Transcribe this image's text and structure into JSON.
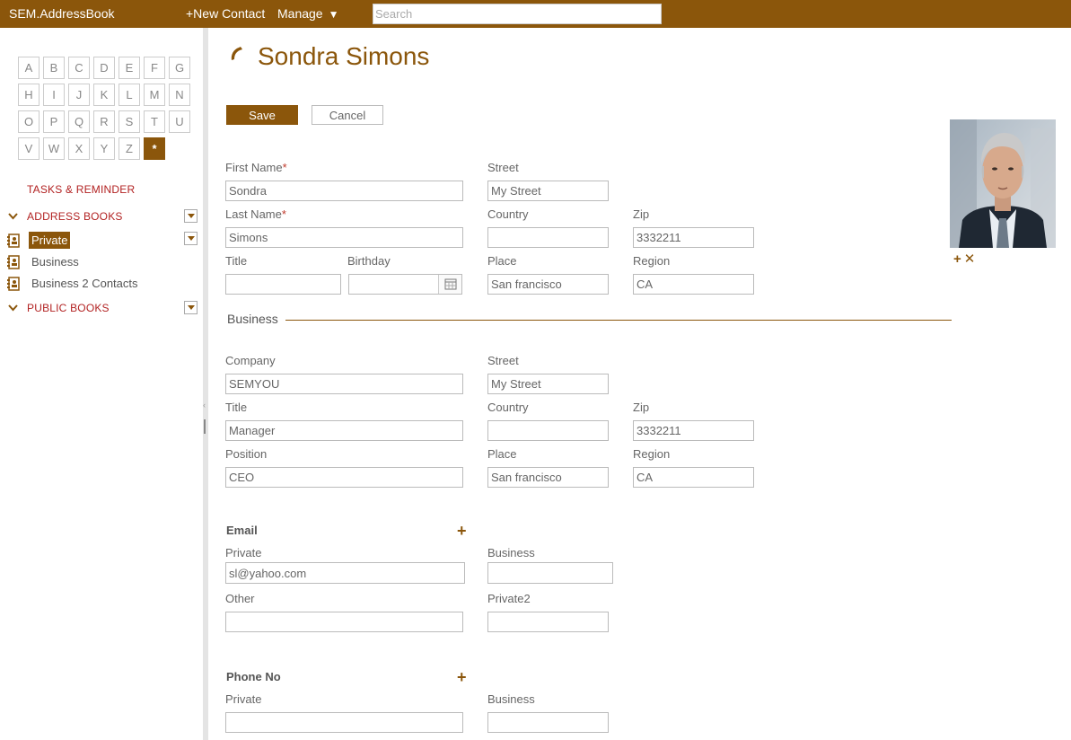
{
  "app": {
    "brand": "SEM.AddressBook",
    "new_contact": "+New Contact",
    "manage": "Manage",
    "search_placeholder": "Search"
  },
  "sidebar": {
    "letters": [
      "A",
      "B",
      "C",
      "D",
      "E",
      "F",
      "G",
      "H",
      "I",
      "J",
      "K",
      "L",
      "M",
      "N",
      "O",
      "P",
      "Q",
      "R",
      "S",
      "T",
      "U",
      "V",
      "W",
      "X",
      "Y",
      "Z",
      "*"
    ],
    "active_letter": "*",
    "tasks": "TASKS & REMINDER",
    "address_books": "ADDRESS BOOKS",
    "books": [
      "Private",
      "Business",
      "Business 2 Contacts"
    ],
    "selected_book": "Private",
    "public_books": "PUBLIC BOOKS"
  },
  "contact": {
    "name": "Sondra Simons",
    "save": "Save",
    "cancel": "Cancel",
    "labels": {
      "first_name": "First Name",
      "last_name": "Last Name",
      "title": "Title",
      "birthday": "Birthday",
      "street": "Street",
      "country": "Country",
      "zip": "Zip",
      "place": "Place",
      "region": "Region",
      "company": "Company",
      "position": "Position",
      "required_mark": "*"
    },
    "private": {
      "first_name": "Sondra",
      "last_name": "Simons",
      "title": "",
      "birthday": "",
      "street": "My Street",
      "country": "",
      "zip": "3332211",
      "place": "San francisco",
      "region": "CA"
    },
    "business_section": "Business",
    "business": {
      "company": "SEMYOU",
      "title": "Manager",
      "position": "CEO",
      "street": "My Street",
      "country": "",
      "zip": "3332211",
      "place": "San francisco",
      "region": "CA"
    },
    "email": {
      "heading": "Email",
      "private_label": "Private",
      "private": "sl@yahoo.com",
      "business_label": "Business",
      "business": "",
      "other_label": "Other",
      "other": "",
      "private2_label": "Private2",
      "private2": ""
    },
    "phone": {
      "heading": "Phone No",
      "private_label": "Private",
      "private": "",
      "business_label": "Business",
      "business": ""
    }
  },
  "colors": {
    "brand": "#8b560b",
    "accent_red": "#b22222"
  }
}
